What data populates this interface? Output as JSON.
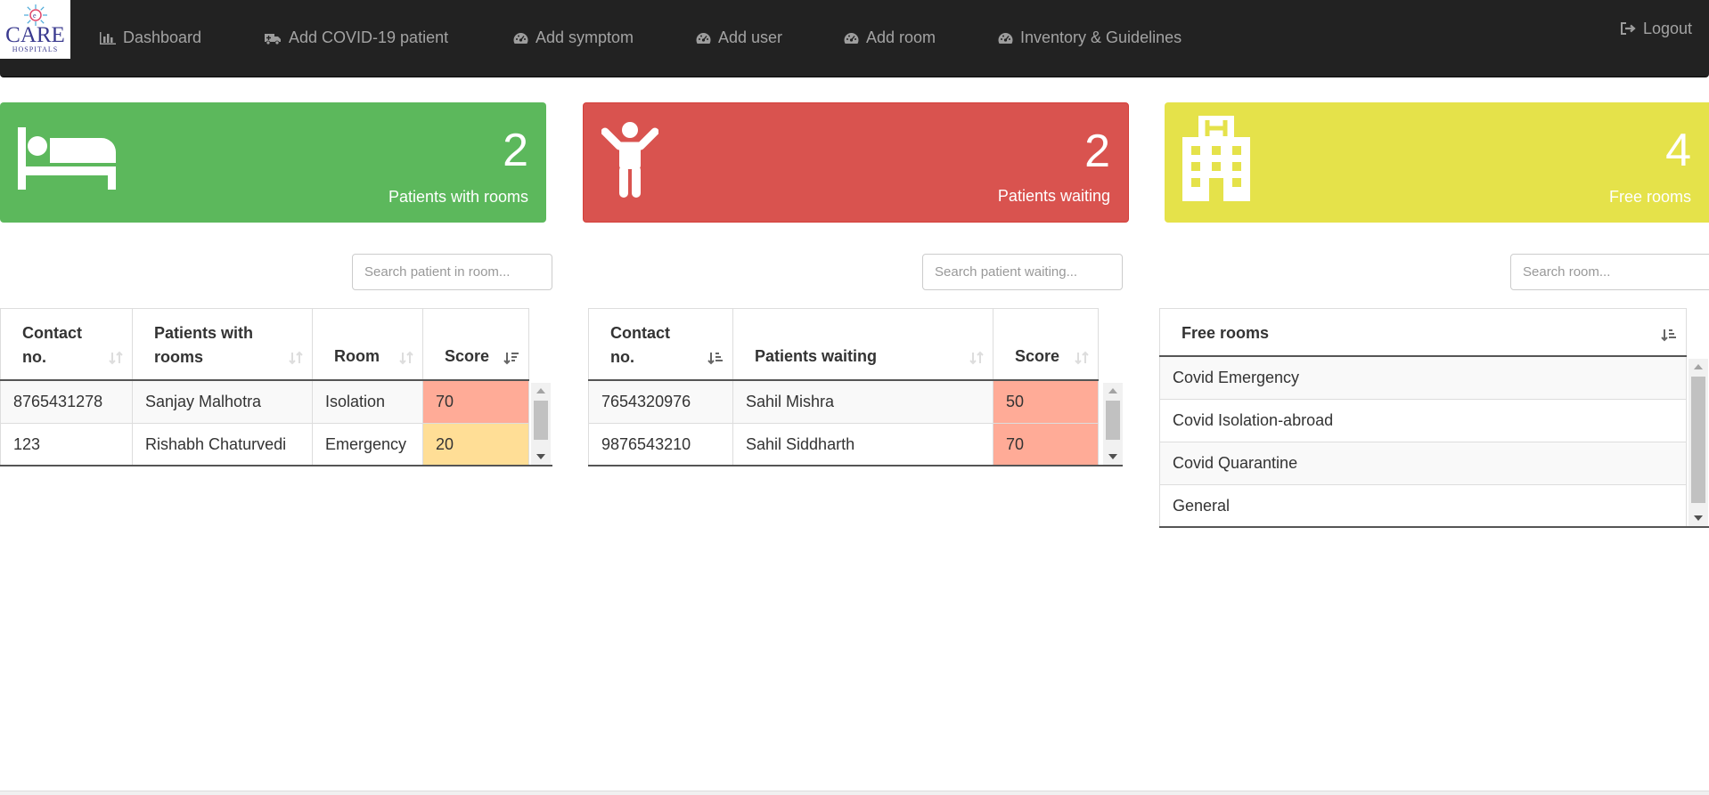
{
  "brand": {
    "name": "CARE",
    "sub": "HOSPITALS"
  },
  "nav": {
    "items": [
      {
        "label": "Dashboard",
        "icon": "bar-chart-icon"
      },
      {
        "label": "Add COVID-19 patient",
        "icon": "ambulance-icon"
      },
      {
        "label": "Add symptom",
        "icon": "dashboard-icon"
      },
      {
        "label": "Add user",
        "icon": "dashboard-icon"
      },
      {
        "label": "Add room",
        "icon": "dashboard-icon"
      },
      {
        "label": "Inventory & Guidelines",
        "icon": "dashboard-icon"
      }
    ],
    "logout": "Logout"
  },
  "panels": {
    "rooms": {
      "count": "2",
      "caption": "Patients with rooms",
      "color": "#5cb85c",
      "icon": "bed-icon"
    },
    "waiting": {
      "count": "2",
      "caption": "Patients waiting",
      "color": "#d9534f",
      "icon": "child-icon"
    },
    "free": {
      "count": "4",
      "caption": "Free rooms",
      "color": "#e5e24a",
      "icon": "hospital-icon"
    }
  },
  "search": {
    "rooms": "Search patient in room...",
    "waiting": "Search patient waiting...",
    "free": "Search room..."
  },
  "tables": {
    "rooms": {
      "headers": {
        "contact_1": "Contact",
        "contact_2": "no.",
        "patients_1": "Patients with",
        "patients_2": "rooms",
        "room": "Room",
        "score": "Score"
      },
      "rows": [
        {
          "contact": "8765431278",
          "name": "Sanjay Malhotra",
          "room": "Isolation",
          "score": "70",
          "score_color": "#ffab97"
        },
        {
          "contact": "123",
          "name": "Rishabh Chaturvedi",
          "room": "Emergency",
          "score": "20",
          "score_color": "#ffde96"
        }
      ]
    },
    "waiting": {
      "headers": {
        "contact_1": "Contact",
        "contact_2": "no.",
        "patients": "Patients waiting",
        "score": "Score"
      },
      "rows": [
        {
          "contact": "7654320976",
          "name": "Sahil Mishra",
          "score": "50",
          "score_color": "#ffab97"
        },
        {
          "contact": "9876543210",
          "name": "Sahil Siddharth",
          "score": "70",
          "score_color": "#ffab97"
        }
      ]
    },
    "free": {
      "header": "Free rooms",
      "rows": [
        "Covid Emergency",
        "Covid Isolation-abroad",
        "Covid Quarantine",
        "General"
      ]
    }
  }
}
